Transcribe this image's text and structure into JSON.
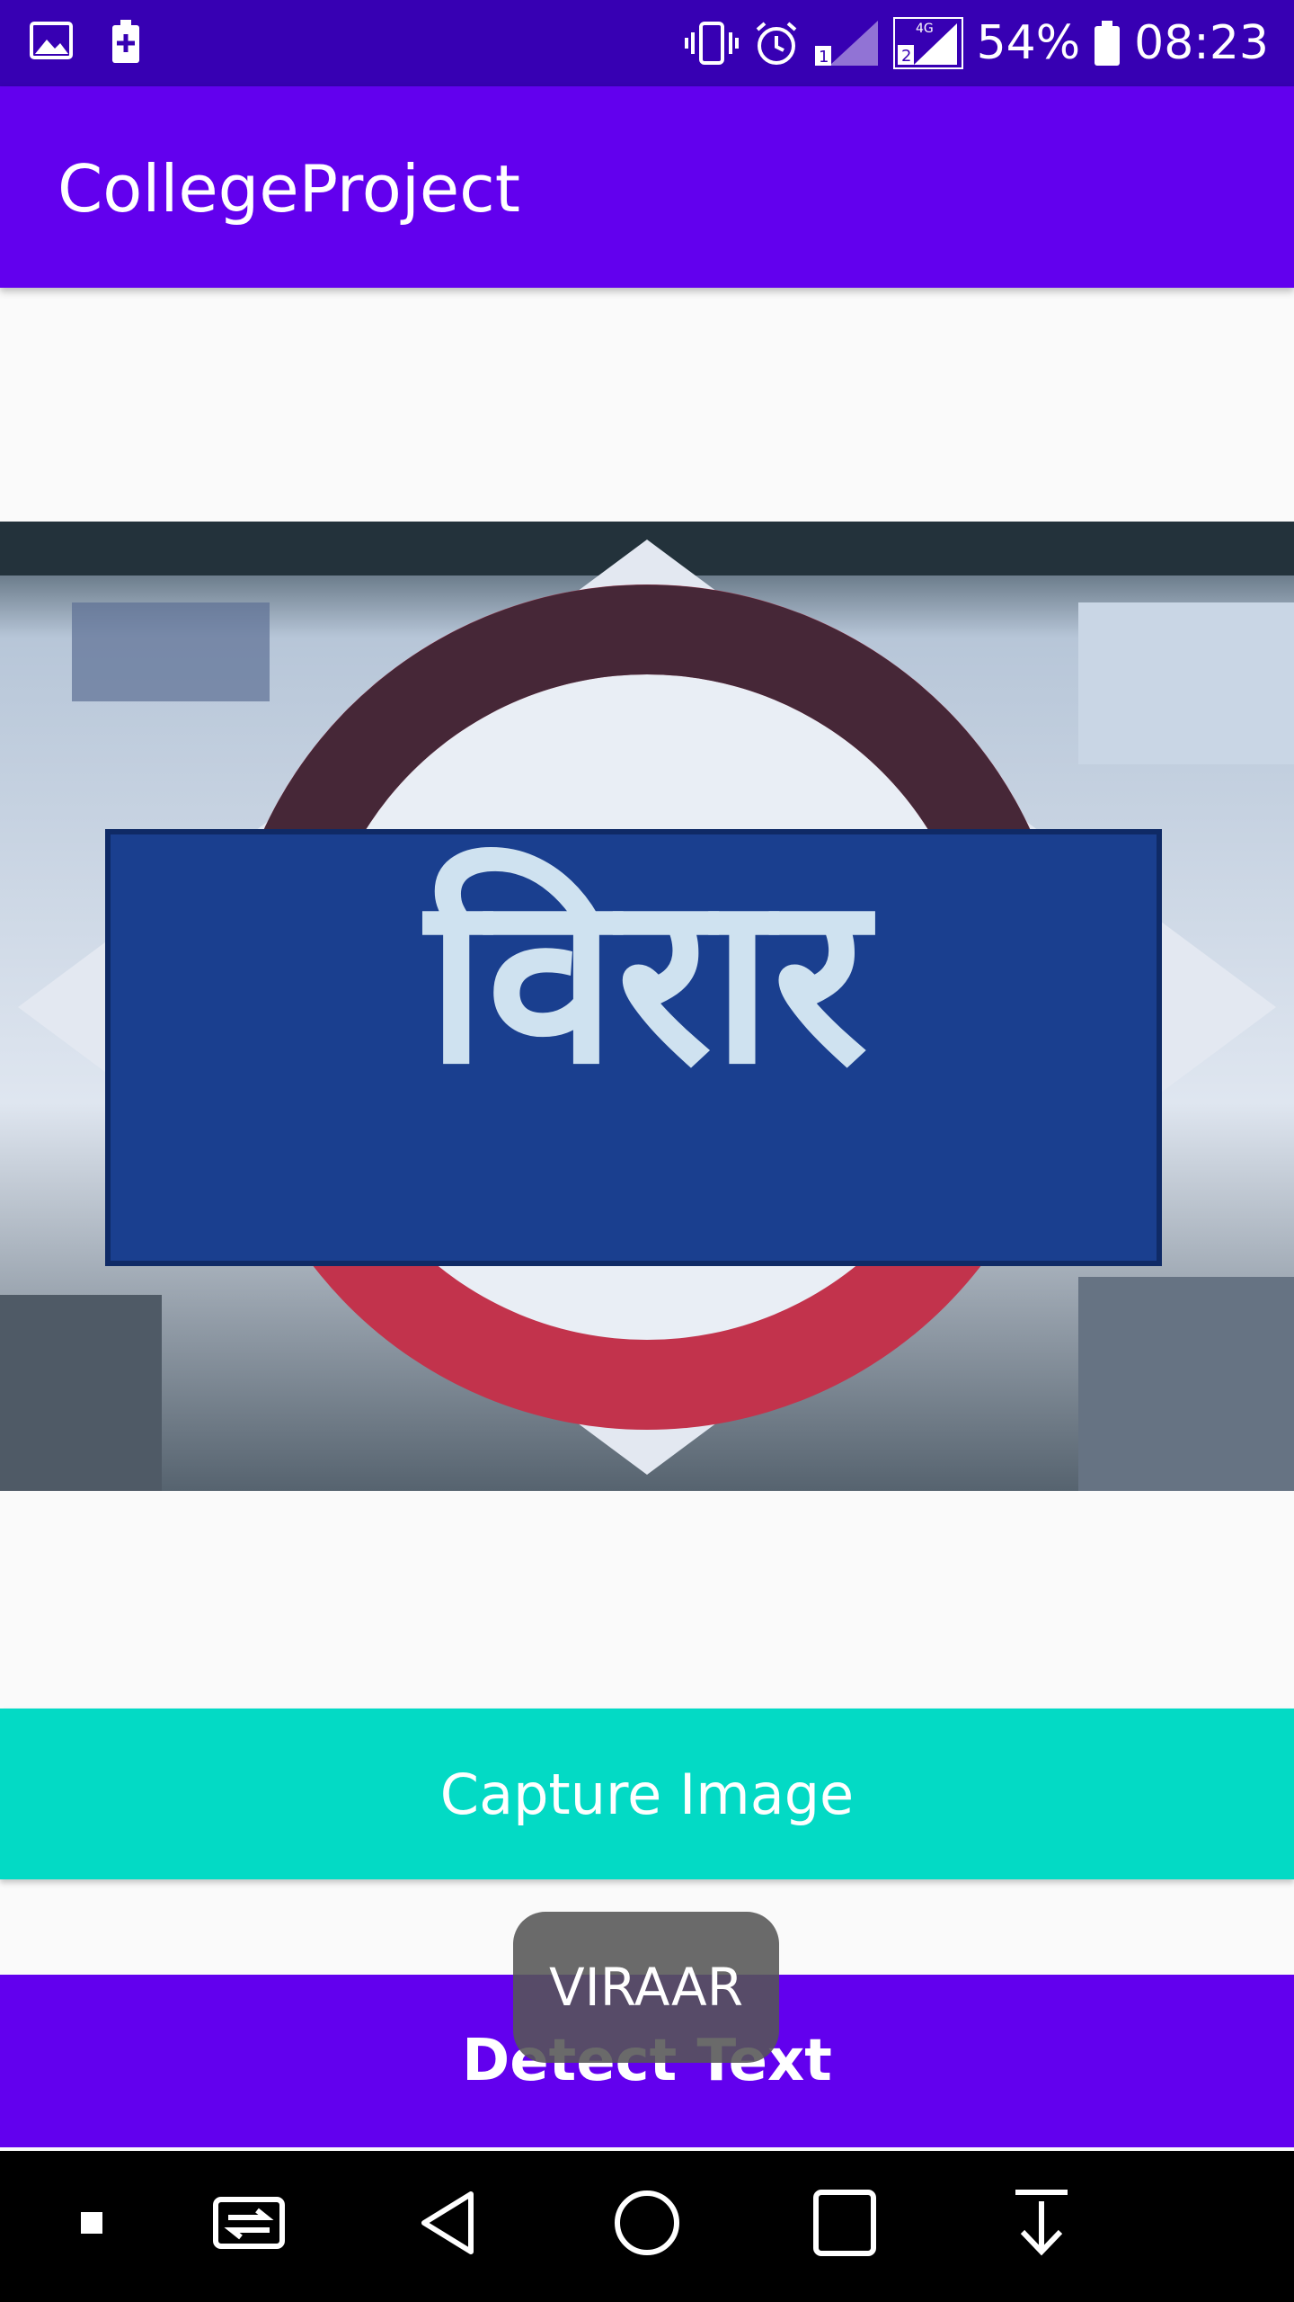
{
  "status_bar": {
    "battery": "54%",
    "time": "08:23",
    "network": "4G",
    "icons": [
      "image-icon",
      "battery-plus-icon",
      "vibrate-icon",
      "alarm-icon",
      "signal-sim1-icon",
      "signal-sim2-icon",
      "battery-icon"
    ]
  },
  "app_bar": {
    "title": "CollegeProject"
  },
  "image": {
    "sign_text": "विरार",
    "colors": {
      "board": "#1a3f8f",
      "ring": "#c2334c",
      "letters": "#cfe2f0"
    }
  },
  "buttons": {
    "capture_label": "Capture Image",
    "detect_label": "Detect Text"
  },
  "toast": {
    "text": "VIRAAR"
  },
  "nav_bar": {
    "icons": [
      "dot-icon",
      "switch-app-icon",
      "back-icon",
      "home-icon",
      "recents-icon",
      "pull-down-icon"
    ]
  },
  "colors": {
    "status_bar": "#3700b3",
    "primary": "#6200ee",
    "accent": "#03dac5",
    "background": "#fafafa"
  }
}
